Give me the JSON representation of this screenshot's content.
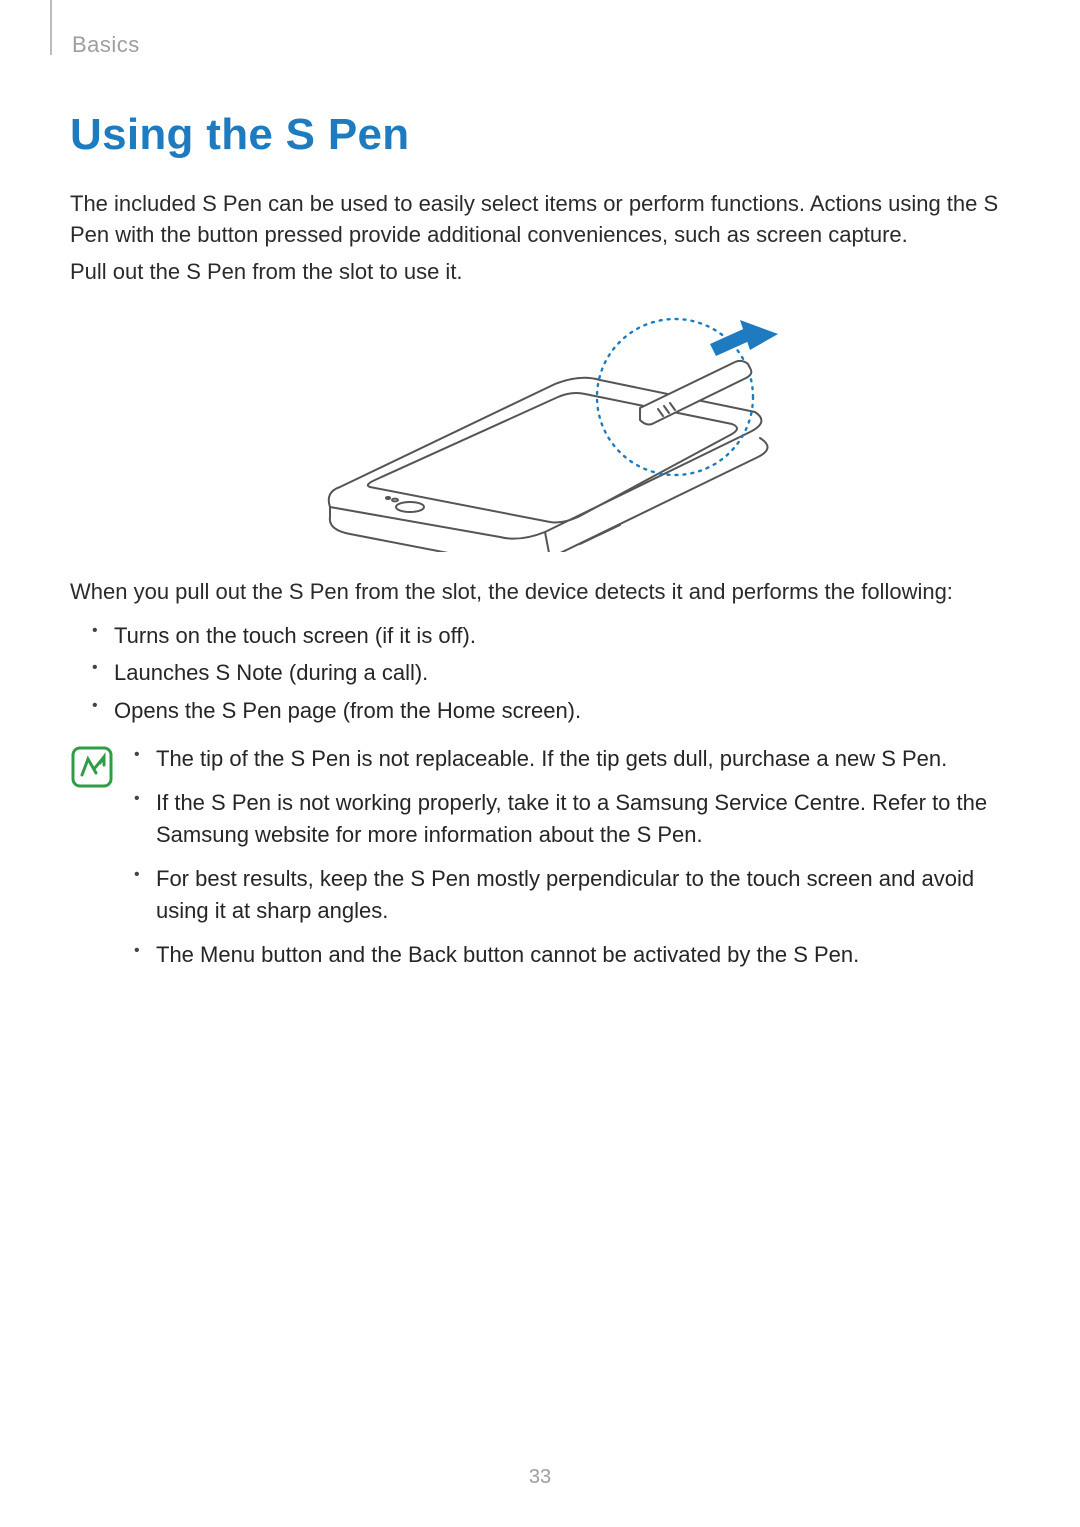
{
  "header": {
    "section": "Basics"
  },
  "title": "Using the S Pen",
  "intro": {
    "p1": "The included S Pen can be used to easily select items or perform functions. Actions using the S Pen with the button pressed provide additional conveniences, such as screen capture.",
    "p2": "Pull out the S Pen from the slot to use it."
  },
  "after_figure": "When you pull out the S Pen from the slot, the device detects it and performs the following:",
  "actions": [
    "Turns on the touch screen (if it is off).",
    "Launches S Note (during a call).",
    "Opens the S Pen page (from the Home screen)."
  ],
  "notes": [
    "The tip of the S Pen is not replaceable. If the tip gets dull, purchase a new S Pen.",
    "If the S Pen is not working properly, take it to a Samsung Service Centre. Refer to the Samsung website for more information about the S Pen.",
    "For best results, keep the S Pen mostly perpendicular to the touch screen and avoid using it at sharp angles.",
    "The Menu button and the Back button cannot be activated by the S Pen."
  ],
  "page_number": "33"
}
